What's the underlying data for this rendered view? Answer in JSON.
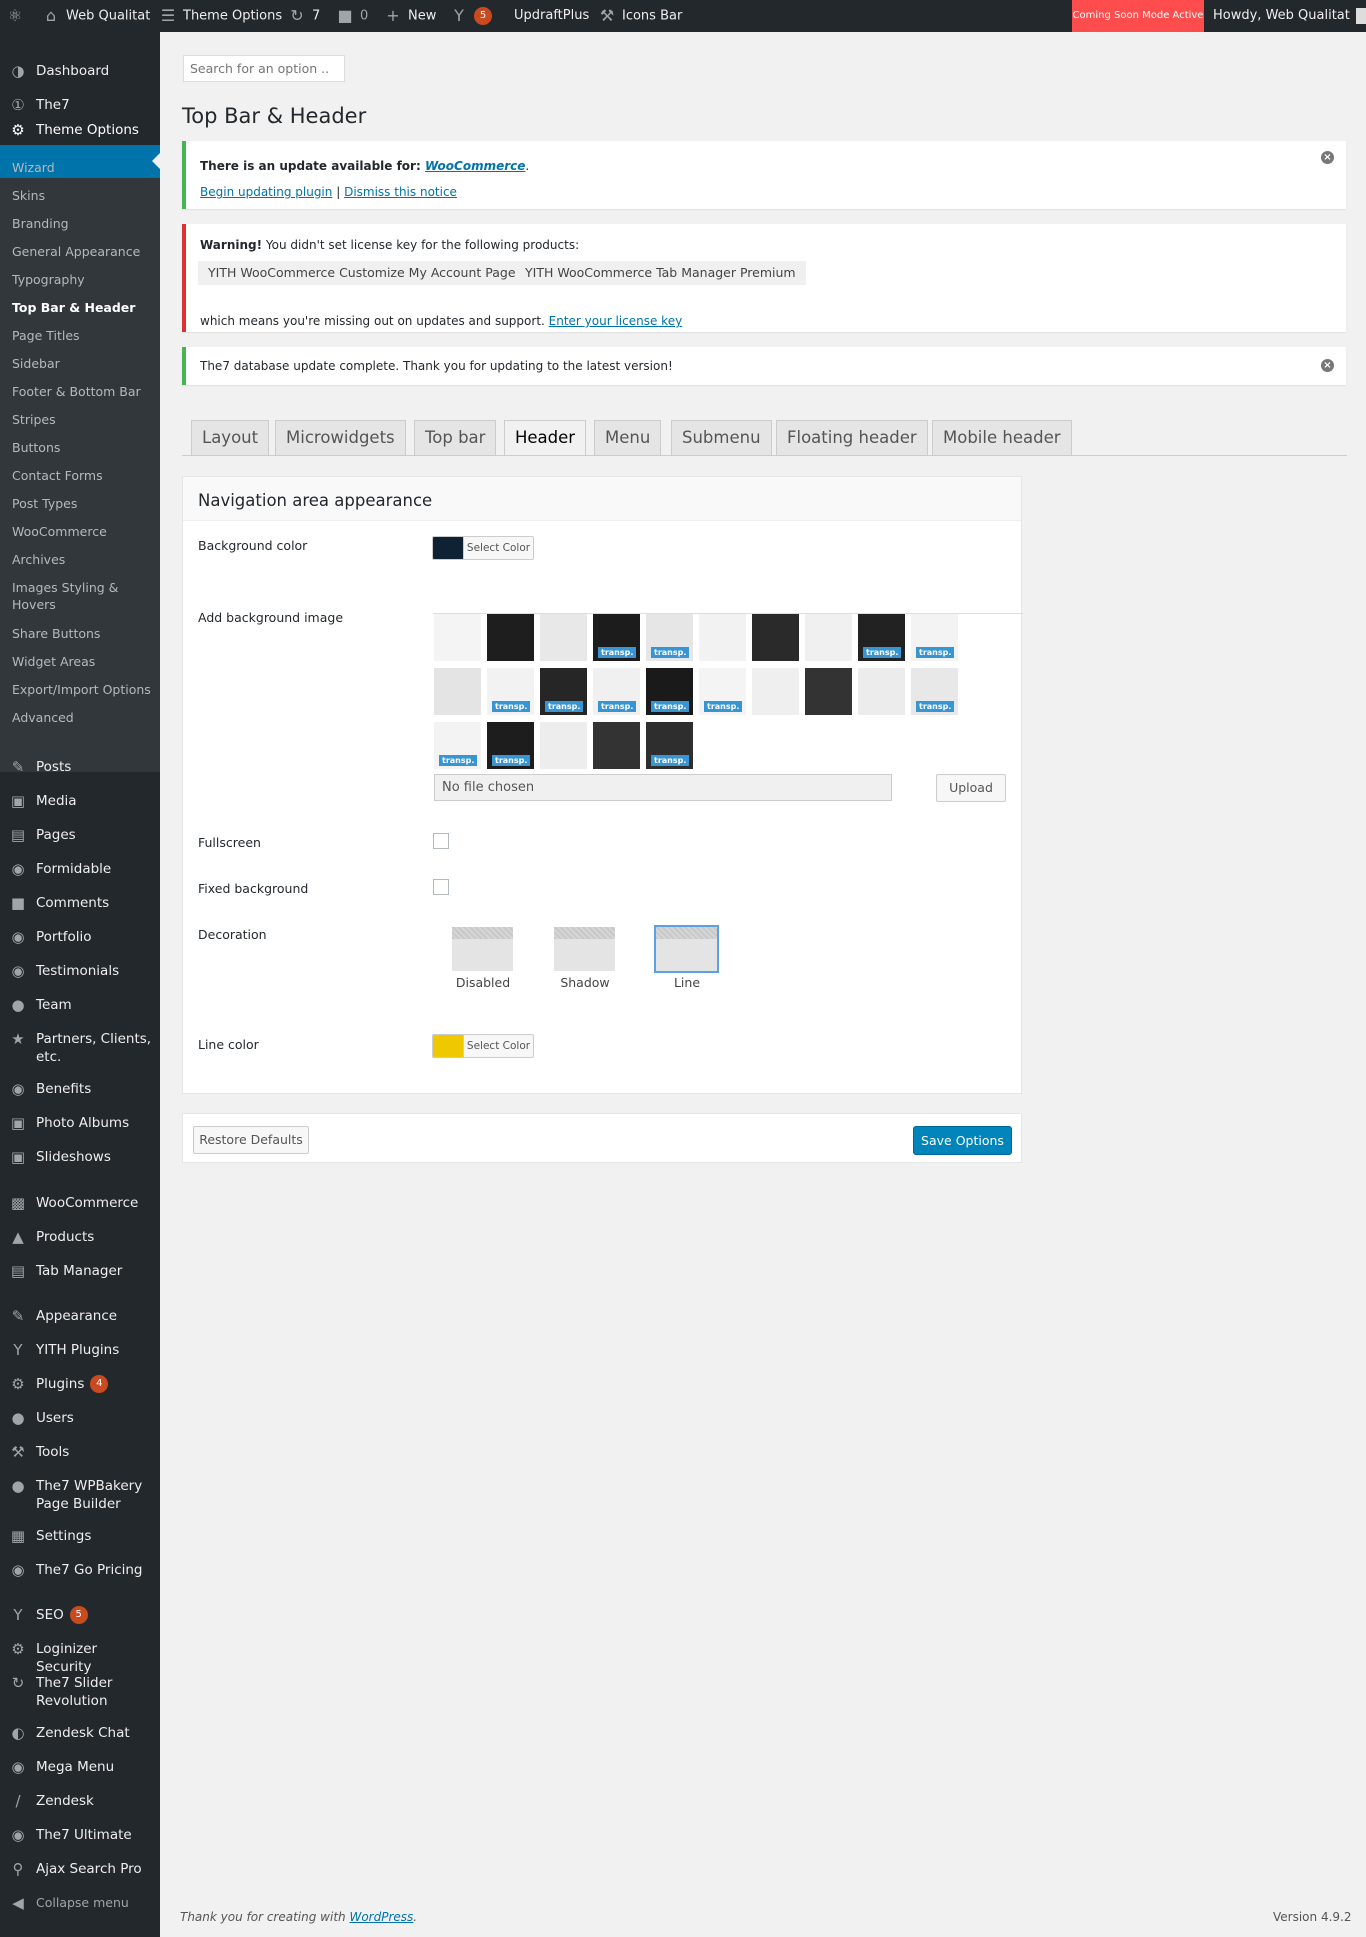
{
  "adminbar": {
    "site_name": "Web Qualitat",
    "theme_options": "Theme Options",
    "updates_count": "7",
    "comments_count": "0",
    "new_label": "New",
    "yoast_badge": "5",
    "updraft": "UpdraftPlus",
    "icons_bar": "Icons Bar",
    "coming_soon": "Coming Soon Mode Active",
    "howdy": "Howdy, Web Qualitat"
  },
  "sidebar": {
    "top_items": [
      "Dashboard",
      "The7"
    ],
    "active": "Theme Options",
    "submenu": [
      "Wizard",
      "Skins",
      "Branding",
      "General Appearance",
      "Typography",
      "Top Bar & Header",
      "Page Titles",
      "Sidebar",
      "Footer & Bottom Bar",
      "Stripes",
      "Buttons",
      "Contact Forms",
      "Post Types",
      "WooCommerce",
      "Archives",
      "Images Styling & Hovers",
      "Share Buttons",
      "Widget Areas",
      "Export/Import Options",
      "Advanced"
    ],
    "items": [
      "Posts",
      "Media",
      "Pages",
      "Formidable",
      "Comments",
      "Portfolio",
      "Testimonials",
      "Team",
      "Partners, Clients, etc.",
      "Benefits",
      "Photo Albums",
      "Slideshows",
      "WooCommerce",
      "Products",
      "Tab Manager",
      "Appearance",
      "YITH Plugins",
      "Plugins",
      "Users",
      "Tools",
      "The7 WPBakery Page Builder",
      "Settings",
      "The7 Go Pricing",
      "SEO",
      "Loginizer Security",
      "The7 Slider Revolution",
      "Zendesk Chat",
      "Mega Menu",
      "Zendesk",
      "The7 Ultimate",
      "Ajax Search Pro",
      "Collapse menu"
    ],
    "plugins_badge": "4",
    "seo_badge": "5"
  },
  "search": {
    "placeholder": "Search for an option .."
  },
  "page_title": "Top Bar & Header",
  "notice_update": {
    "text": "There is an update available for: ",
    "plugin": "WooCommerce",
    "period": ".",
    "begin": "Begin updating plugin",
    "sep": "|",
    "dismiss": "Dismiss this notice"
  },
  "notice_license": {
    "warning": "Warning!",
    "text": " You didn't set license key for the following products:",
    "products": [
      "YITH WooCommerce Customize My Account Page",
      "YITH WooCommerce Tab Manager Premium"
    ],
    "missing": "which means you're missing out on updates and support. ",
    "enter": "Enter your license key"
  },
  "notice_db": {
    "text": "The7 database update complete. Thank you for updating to the latest version!"
  },
  "tabs": [
    "Layout",
    "Microwidgets",
    "Top bar",
    "Header",
    "Menu",
    "Submenu",
    "Floating header",
    "Mobile header"
  ],
  "panel": {
    "title": "Navigation area appearance",
    "bg_color_label": "Background color",
    "bg_color": "#0e2233",
    "select_color": "Select Color",
    "bg_image_label": "Add background image",
    "transp": "transp.",
    "no_file": "No file chosen",
    "upload": "Upload",
    "fullscreen": "Fullscreen",
    "fixed_bg": "Fixed background",
    "decoration": "Decoration",
    "deco_options": [
      "Disabled",
      "Shadow",
      "Line"
    ],
    "deco_selected": "Line",
    "line_color_label": "Line color",
    "line_color": "#f0c800"
  },
  "actions": {
    "restore": "Restore Defaults",
    "save": "Save Options"
  },
  "footer": {
    "thanks": "Thank you for creating with ",
    "wp": "WordPress",
    "dot": ".",
    "version": "Version 4.9.2"
  }
}
